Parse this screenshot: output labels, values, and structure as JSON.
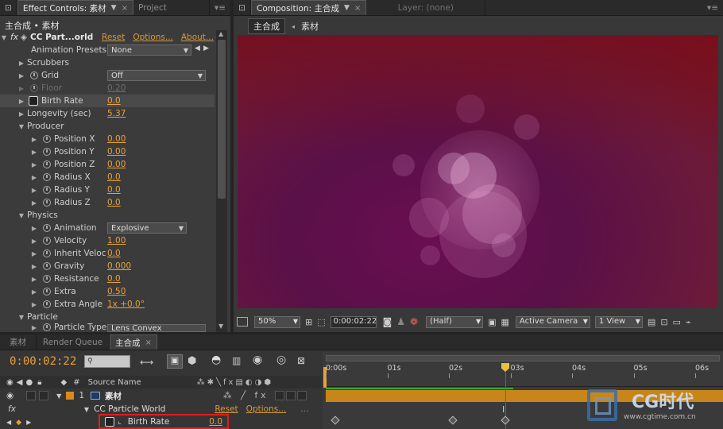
{
  "effect_panel": {
    "tabs": [
      {
        "label": "Effect Controls: 素材",
        "active": true
      },
      {
        "label": "Project",
        "active": false
      }
    ],
    "breadcrumb": "主合成 • 素材",
    "effect_name": "CC Part...orld",
    "reset": "Reset",
    "options": "Options...",
    "about": "About...",
    "presets_label": "Animation Presets:",
    "presets_value": "None",
    "rows": {
      "scrubbers": "Scrubbers",
      "grid": "Grid",
      "grid_value": "Off",
      "floor": "Floor",
      "floor_value": "0.20",
      "birth_rate": "Birth Rate",
      "birth_rate_value": "0.0",
      "longevity": "Longevity (sec)",
      "longevity_value": "5.37",
      "producer": "Producer",
      "position_x": "Position X",
      "position_x_value": "0.00",
      "position_y": "Position Y",
      "position_y_value": "0.00",
      "position_z": "Position Z",
      "position_z_value": "0.00",
      "radius_x": "Radius X",
      "radius_x_value": "0.0",
      "radius_y": "Radius Y",
      "radius_y_value": "0.0",
      "radius_z": "Radius Z",
      "radius_z_value": "0.0",
      "physics": "Physics",
      "animation": "Animation",
      "animation_value": "Explosive",
      "velocity": "Velocity",
      "velocity_value": "1.00",
      "inherit_velocity": "Inherit Veloc",
      "inherit_velocity_value": "0.0",
      "gravity": "Gravity",
      "gravity_value": "0.000",
      "resistance": "Resistance",
      "resistance_value": "0.0",
      "extra": "Extra",
      "extra_value": "0.50",
      "extra_angle": "Extra Angle",
      "extra_angle_value": "1x +0.0°",
      "particle": "Particle",
      "particle_type": "Particle Type",
      "particle_type_value": "Lens Convex"
    }
  },
  "comp_panel": {
    "tabs": [
      {
        "label": "Composition: 主合成",
        "active": true
      },
      {
        "label": "Layer: (none)",
        "active": false
      }
    ],
    "crumbs": [
      "主合成",
      "素材"
    ],
    "bottom": {
      "zoom": "50%",
      "timecode": "0:00:02:22",
      "resolution": "(Half)",
      "camera": "Active Camera",
      "views": "1 View"
    }
  },
  "timeline": {
    "tabs": [
      {
        "label": "素材",
        "active": false
      },
      {
        "label": "Render Queue",
        "active": false
      },
      {
        "label": "主合成",
        "active": true
      }
    ],
    "timecode": "0:00:02:22",
    "source_name_header": "Source Name",
    "layer_name": "素材",
    "effect_name": "CC Particle World",
    "reset": "Reset",
    "options": "Options...",
    "property": "Birth Rate",
    "property_value": "0.0",
    "ruler": [
      "0:00s",
      "01s",
      "02s",
      "03s",
      "04s",
      "05s",
      "06s"
    ]
  },
  "watermark": {
    "brand": "CG时代",
    "url": "www.cgtime.com.cn"
  },
  "colors": {
    "accent": "#e8a23a",
    "layer_bar": "#c8861a",
    "playhead": "#e0302a",
    "highlight_box": "#e01e1e",
    "comp_bg": "#7a1e4a"
  }
}
